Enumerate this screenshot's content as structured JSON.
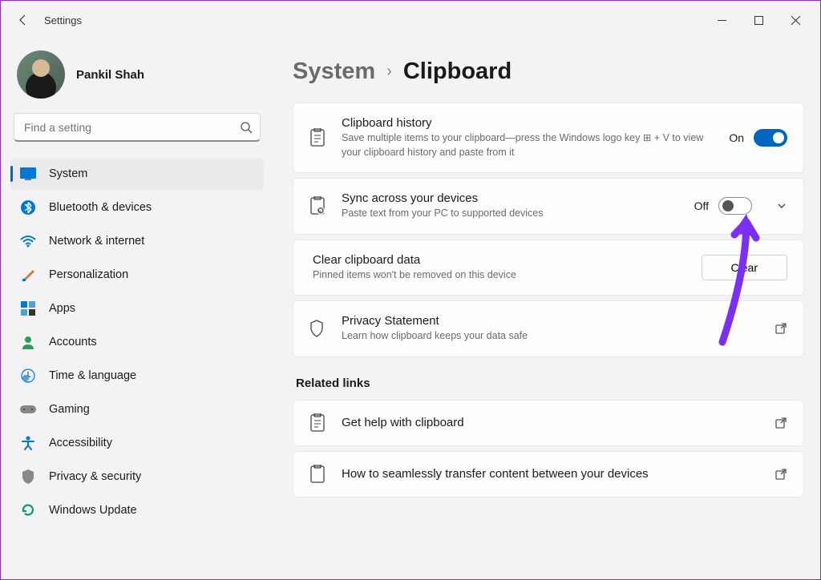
{
  "window": {
    "title": "Settings"
  },
  "profile": {
    "name": "Pankil Shah"
  },
  "search": {
    "placeholder": "Find a setting"
  },
  "nav": {
    "items": [
      {
        "label": "System"
      },
      {
        "label": "Bluetooth & devices"
      },
      {
        "label": "Network & internet"
      },
      {
        "label": "Personalization"
      },
      {
        "label": "Apps"
      },
      {
        "label": "Accounts"
      },
      {
        "label": "Time & language"
      },
      {
        "label": "Gaming"
      },
      {
        "label": "Accessibility"
      },
      {
        "label": "Privacy & security"
      },
      {
        "label": "Windows Update"
      }
    ]
  },
  "breadcrumb": {
    "parent": "System",
    "current": "Clipboard"
  },
  "cards": {
    "history": {
      "title": "Clipboard history",
      "sub": "Save multiple items to your clipboard—press the Windows logo key ⊞ + V to view your clipboard history and paste from it",
      "state_label": "On"
    },
    "sync": {
      "title": "Sync across your devices",
      "sub": "Paste text from your PC to supported devices",
      "state_label": "Off"
    },
    "clear": {
      "title": "Clear clipboard data",
      "sub": "Pinned items won't be removed on this device",
      "button": "Clear"
    },
    "privacy": {
      "title": "Privacy Statement",
      "sub": "Learn how clipboard keeps your data safe"
    }
  },
  "related": {
    "heading": "Related links",
    "help": "Get help with clipboard",
    "transfer": "How to seamlessly transfer content between your devices"
  },
  "colors": {
    "accent": "#0067c0"
  }
}
